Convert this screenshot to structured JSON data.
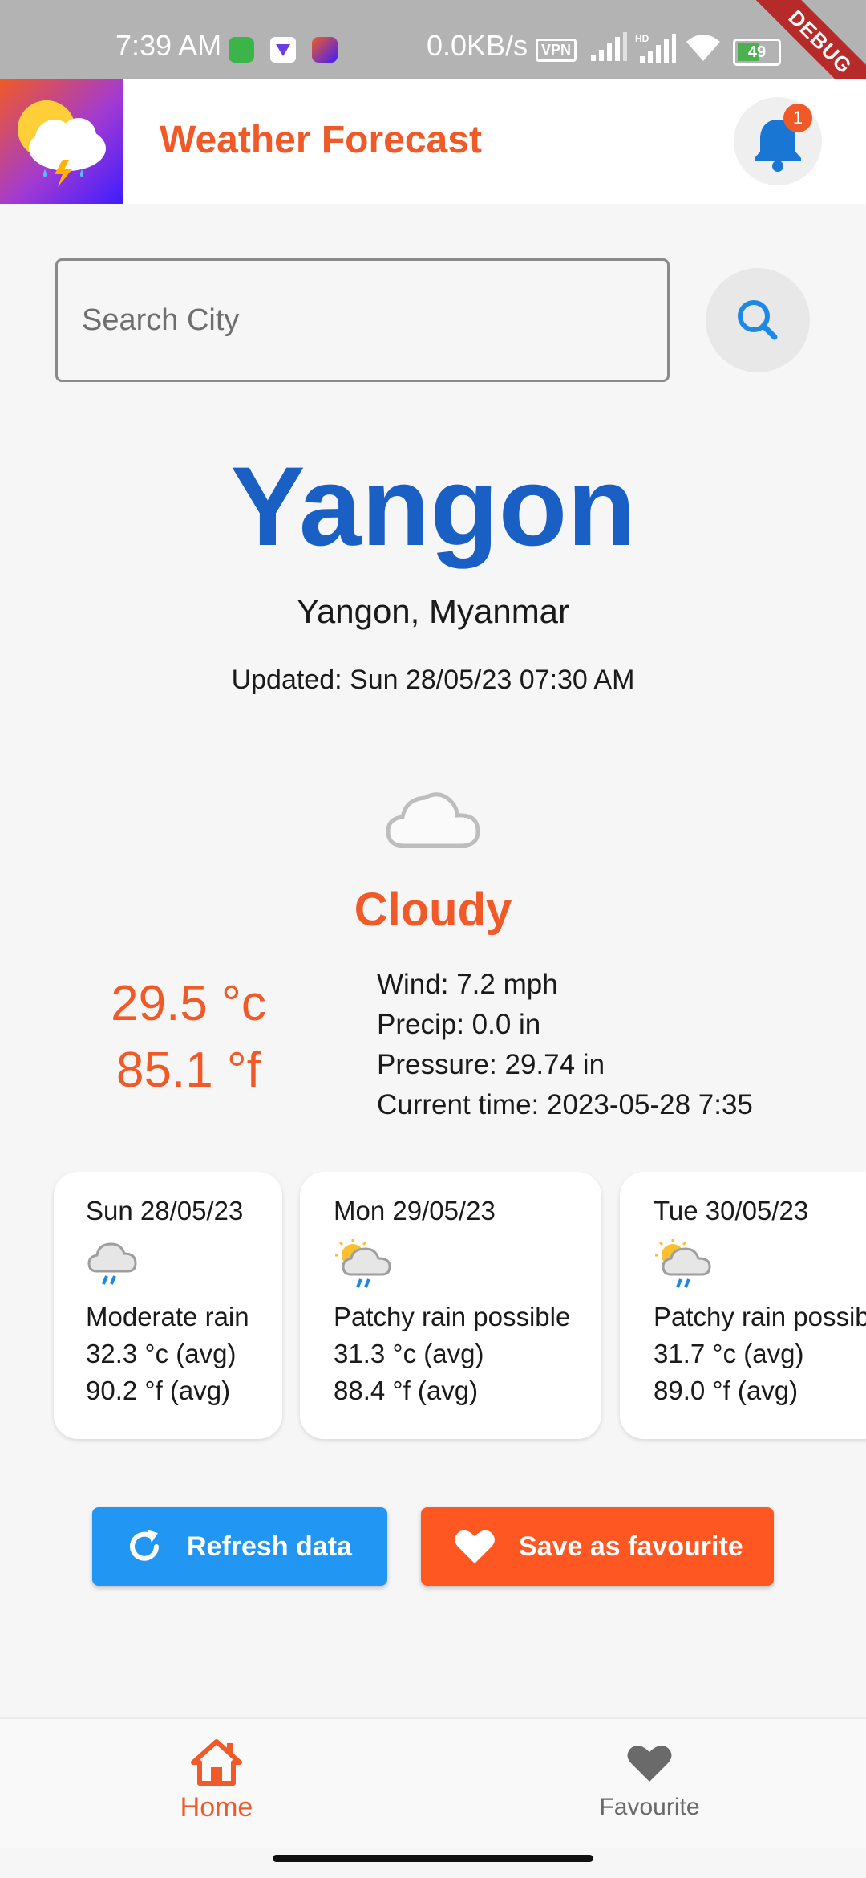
{
  "status_bar": {
    "time": "7:39 AM",
    "network_speed": "0.0KB/s",
    "vpn_label": "VPN",
    "battery": "49",
    "debug_label": "DEBUG"
  },
  "app_bar": {
    "title": "Weather Forecast",
    "notification_count": "1"
  },
  "search": {
    "placeholder": "Search City",
    "value": ""
  },
  "location": {
    "city": "Yangon",
    "region": "Yangon, Myanmar",
    "updated": "Updated: Sun 28/05/23 07:30 AM"
  },
  "current": {
    "condition": "Cloudy",
    "temp_c": "29.5 °c",
    "temp_f": "85.1 °f",
    "wind": "Wind: 7.2 mph",
    "precip": "Precip: 0.0 in",
    "pressure": "Pressure: 29.74 in",
    "current_time": "Current time: 2023-05-28 7:35"
  },
  "forecast": [
    {
      "date": "Sun 28/05/23",
      "icon": "rain-cloud-icon",
      "description": "Moderate rain",
      "temp_c": "32.3 °c (avg)",
      "temp_f": "90.2 °f (avg)"
    },
    {
      "date": "Mon 29/05/23",
      "icon": "sun-rain-cloud-icon",
      "description": "Patchy rain possible",
      "temp_c": "31.3 °c (avg)",
      "temp_f": "88.4 °f (avg)"
    },
    {
      "date": "Tue 30/05/23",
      "icon": "sun-rain-cloud-icon",
      "description": "Patchy rain possible",
      "temp_c": "31.7 °c (avg)",
      "temp_f": "89.0 °f (avg)"
    }
  ],
  "actions": {
    "refresh_label": "Refresh data",
    "favourite_label": "Save as favourite"
  },
  "bottom_nav": {
    "home_label": "Home",
    "favourite_label": "Favourite"
  },
  "colors": {
    "accent": "#f05a28",
    "city": "#1a5fc4",
    "refresh": "#2196f3",
    "favourite": "#ff5722"
  }
}
